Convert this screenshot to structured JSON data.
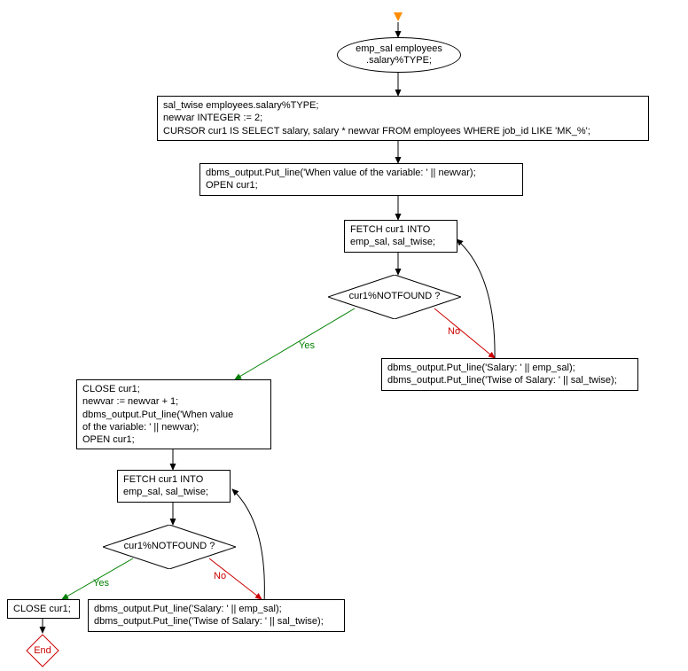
{
  "start": {
    "text_line1": "emp_sal employees",
    "text_line2": ".salary%TYPE;"
  },
  "declare_block": {
    "line1": "sal_twise employees.salary%TYPE;",
    "line2": "newvar  INTEGER := 2;",
    "line3": "CURSOR cur1 IS SELECT salary, salary * newvar FROM employees WHERE  job_id LIKE 'MK_%';"
  },
  "open1": {
    "line1": "dbms_output.Put_line('When value of the variable: ' || newvar);",
    "line2": "OPEN cur1;"
  },
  "fetch1": {
    "line1": "FETCH cur1 INTO",
    "line2": "emp_sal, sal_twise;"
  },
  "cond1": {
    "text": "cur1%NOTFOUND ?"
  },
  "output1": {
    "line1": "dbms_output.Put_line('Salary: ' || emp_sal);",
    "line2": "dbms_output.Put_line('Twise of Salary:  ' || sal_twise);"
  },
  "reinit": {
    "line1": "CLOSE cur1;",
    "line2": "newvar := newvar + 1;",
    "line3": "dbms_output.Put_line('When value",
    "line4": "of the variable:  ' || newvar);",
    "line5": "OPEN cur1;"
  },
  "fetch2": {
    "line1": "FETCH cur1 INTO",
    "line2": "emp_sal, sal_twise;"
  },
  "cond2": {
    "text": "cur1%NOTFOUND ?"
  },
  "close2": {
    "text": "CLOSE cur1;"
  },
  "output2": {
    "line1": "dbms_output.Put_line('Salary: ' || emp_sal);",
    "line2": "dbms_output.Put_line('Twise of Salary:  ' || sal_twise);"
  },
  "end_node": {
    "text": "End"
  },
  "labels": {
    "yes": "Yes",
    "no": "No"
  }
}
